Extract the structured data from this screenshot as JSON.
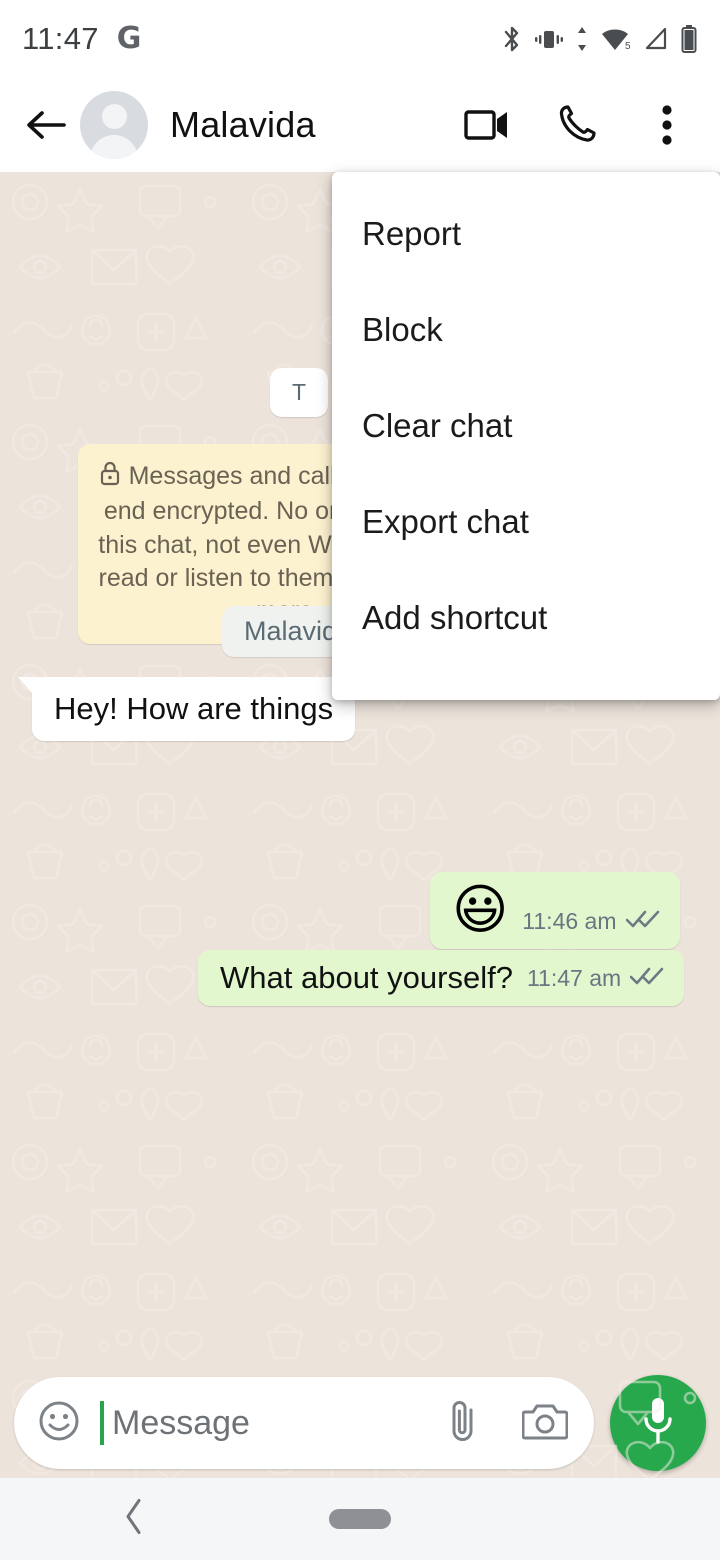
{
  "status_bar": {
    "time": "11:47",
    "google_badge": "G",
    "icons": [
      "bluetooth-icon",
      "vibrate-icon",
      "data-transfer-icon",
      "wifi-icon",
      "signal-icon",
      "battery-icon"
    ],
    "wifi_label": "5"
  },
  "app_bar": {
    "back_label": "Back",
    "contact_name": "Malavida",
    "actions": [
      "video-call",
      "voice-call",
      "overflow-menu"
    ]
  },
  "menu": {
    "items": [
      {
        "label": "Report"
      },
      {
        "label": "Block"
      },
      {
        "label": "Clear chat"
      },
      {
        "label": "Export chat"
      },
      {
        "label": "Add shortcut"
      }
    ]
  },
  "chat": {
    "date_chip": "T",
    "encryption_notice": "Messages and calls are end-to-end encrypted. No one outside of this chat, not even WhatsApp, can read or listen to them. Tap to learn more.",
    "encryption_notice_visible": "Messages an\nencrypted. No one\neven WhatsApp, ca\nTap to",
    "system_chip": "Malavida",
    "messages": [
      {
        "type": "incoming",
        "text": "Hey! How are things",
        "full_text": "Hey! How are things?"
      },
      {
        "type": "outgoing",
        "text": "😃",
        "time": "11:46 am",
        "status": "delivered"
      },
      {
        "type": "outgoing",
        "text": "What about yourself?",
        "time": "11:47 am",
        "status": "delivered"
      }
    ]
  },
  "input_bar": {
    "placeholder": "Message",
    "emoji_icon": "emoji-icon",
    "attach_icon": "paperclip-icon",
    "camera_icon": "camera-icon",
    "mic_icon": "microphone-icon"
  },
  "nav_bar": {
    "back": "nav-back-icon",
    "home": "nav-home-pill"
  },
  "colors": {
    "chat_background": "#ece3da",
    "outgoing_bubble": "#e3f7cf",
    "incoming_bubble": "#ffffff",
    "encryption_bubble": "#fdf2d0",
    "accent_green": "#27a84c",
    "meta_text": "#667781"
  }
}
